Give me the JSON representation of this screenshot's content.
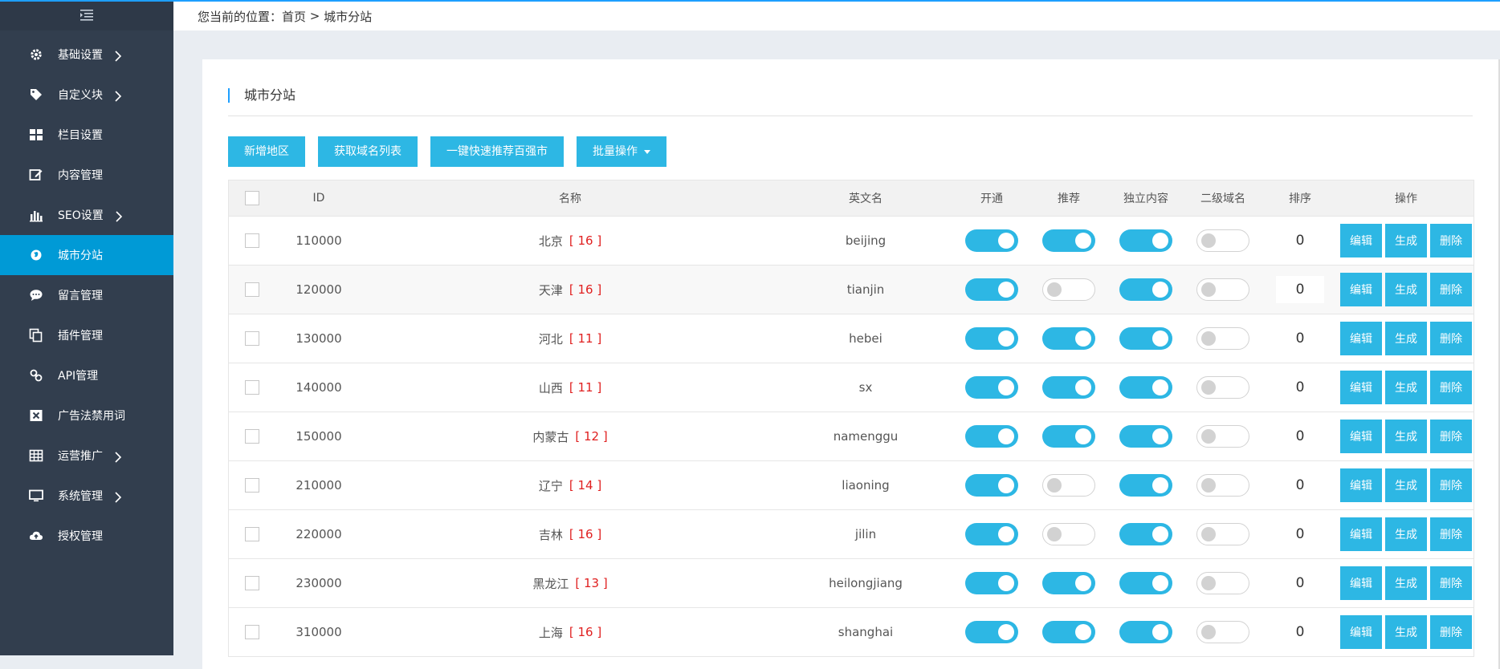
{
  "sidebar": {
    "items": [
      {
        "label": "基础设置",
        "icon": "gear-icon",
        "arrow": true
      },
      {
        "label": "自定义块",
        "icon": "tag-icon",
        "arrow": true
      },
      {
        "label": "栏目设置",
        "icon": "grid-icon",
        "arrow": false
      },
      {
        "label": "内容管理",
        "icon": "edit-icon",
        "arrow": false
      },
      {
        "label": "SEO设置",
        "icon": "bar-chart-icon",
        "arrow": true
      },
      {
        "label": "城市分站",
        "icon": "globe-icon",
        "arrow": false,
        "active": true
      },
      {
        "label": "留言管理",
        "icon": "chat-icon",
        "arrow": false
      },
      {
        "label": "插件管理",
        "icon": "copy-icon",
        "arrow": false
      },
      {
        "label": "API管理",
        "icon": "link-icon",
        "arrow": false
      },
      {
        "label": "广告法禁用词",
        "icon": "close-box-icon",
        "arrow": false
      },
      {
        "label": "运营推广",
        "icon": "table-icon",
        "arrow": true
      },
      {
        "label": "系统管理",
        "icon": "monitor-icon",
        "arrow": true
      },
      {
        "label": "授权管理",
        "icon": "cloud-upload-icon",
        "arrow": false
      }
    ]
  },
  "breadcrumb": {
    "prefix": "您当前的位置：",
    "home": "首页",
    "sep": " > ",
    "current": "城市分站"
  },
  "panel": {
    "title": "城市分站"
  },
  "toolbar": {
    "add": "新增地区",
    "fetch": "获取域名列表",
    "recommend": "一键快速推荐百强市",
    "batch": "批量操作"
  },
  "table": {
    "headers": {
      "id": "ID",
      "name": "名称",
      "en": "英文名",
      "open": "开通",
      "recommend": "推荐",
      "independent": "独立内容",
      "subdomain": "二级域名",
      "sort": "排序",
      "ops": "操作"
    },
    "op_labels": {
      "edit": "编辑",
      "generate": "生成",
      "delete": "删除"
    },
    "rows": [
      {
        "id": "110000",
        "name": "北京",
        "count": "[ 16 ]",
        "en": "beijing",
        "open": true,
        "recommend": true,
        "independent": true,
        "subdomain": false,
        "sort": "0"
      },
      {
        "id": "120000",
        "name": "天津",
        "count": "[ 16 ]",
        "en": "tianjin",
        "open": true,
        "recommend": false,
        "independent": true,
        "subdomain": false,
        "sort": "0"
      },
      {
        "id": "130000",
        "name": "河北",
        "count": "[ 11 ]",
        "en": "hebei",
        "open": true,
        "recommend": true,
        "independent": true,
        "subdomain": false,
        "sort": "0"
      },
      {
        "id": "140000",
        "name": "山西",
        "count": "[ 11 ]",
        "en": "sx",
        "open": true,
        "recommend": true,
        "independent": true,
        "subdomain": false,
        "sort": "0"
      },
      {
        "id": "150000",
        "name": "内蒙古",
        "count": "[ 12 ]",
        "en": "namenggu",
        "open": true,
        "recommend": true,
        "independent": true,
        "subdomain": false,
        "sort": "0"
      },
      {
        "id": "210000",
        "name": "辽宁",
        "count": "[ 14 ]",
        "en": "liaoning",
        "open": true,
        "recommend": false,
        "independent": true,
        "subdomain": false,
        "sort": "0"
      },
      {
        "id": "220000",
        "name": "吉林",
        "count": "[ 16 ]",
        "en": "jilin",
        "open": true,
        "recommend": false,
        "independent": true,
        "subdomain": false,
        "sort": "0"
      },
      {
        "id": "230000",
        "name": "黑龙江",
        "count": "[ 13 ]",
        "en": "heilongjiang",
        "open": true,
        "recommend": true,
        "independent": true,
        "subdomain": false,
        "sort": "0"
      },
      {
        "id": "310000",
        "name": "上海",
        "count": "[ 16 ]",
        "en": "shanghai",
        "open": true,
        "recommend": true,
        "independent": true,
        "subdomain": false,
        "sort": "0"
      }
    ]
  },
  "colors": {
    "accent": "#2db7e4",
    "active_menu": "#009ad6",
    "sidebar_bg": "#323e4e",
    "count_red": "#e02020"
  }
}
